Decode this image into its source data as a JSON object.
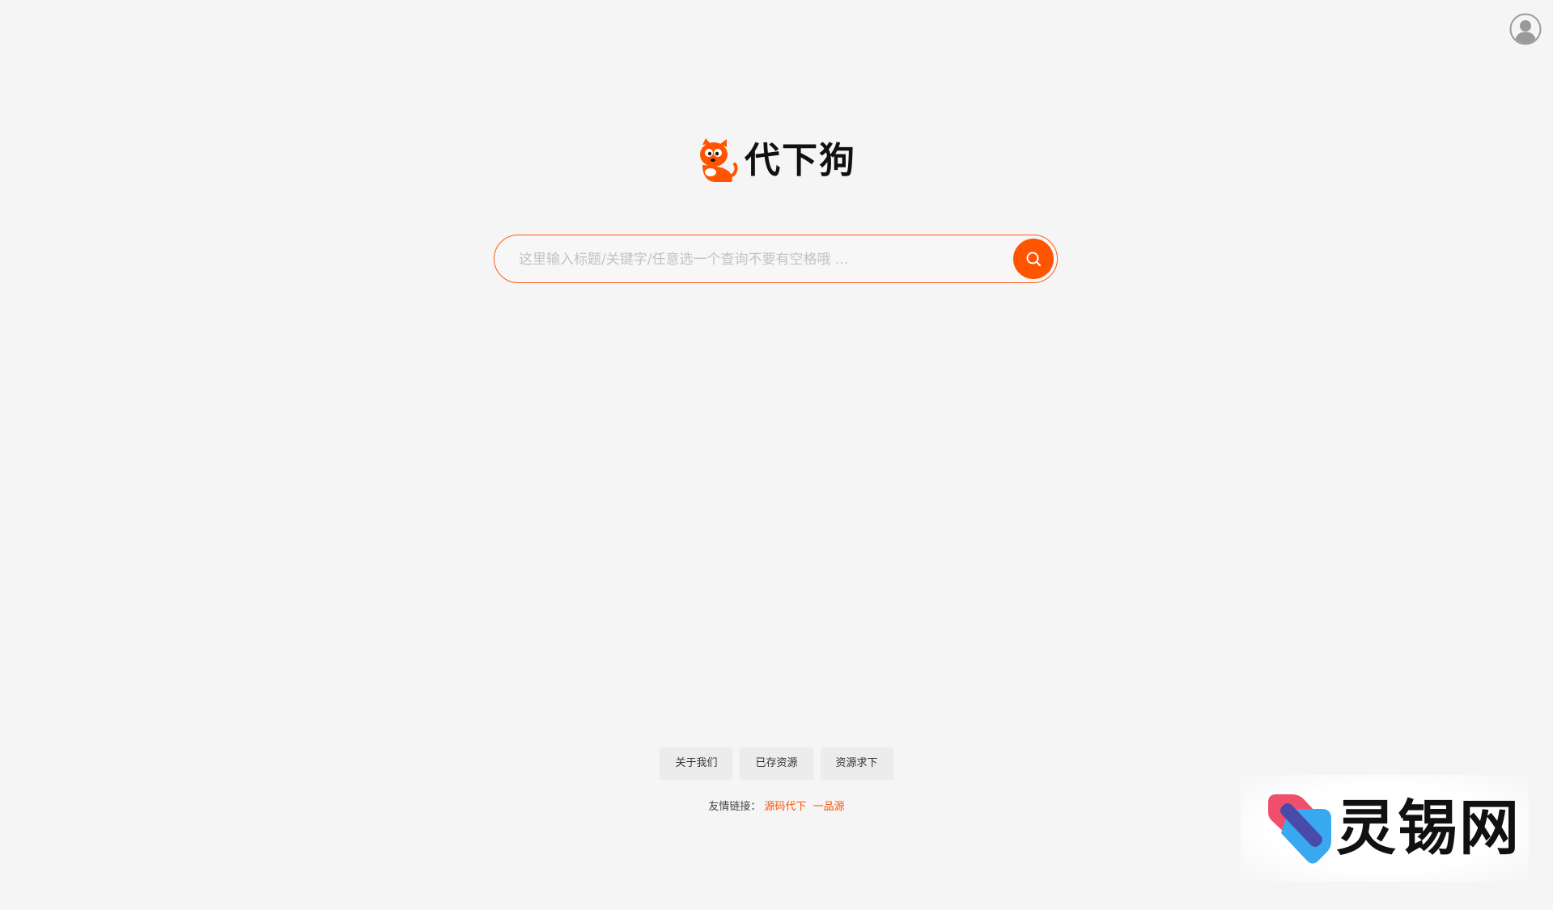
{
  "header": {
    "avatar_icon": "user-avatar-icon"
  },
  "logo": {
    "text": "代下狗",
    "brand_color": "#ff5400",
    "mascot_icon": "dog-mascot-icon"
  },
  "search": {
    "placeholder": "这里输入标题/关键字/任意选一个查询不要有空格哦 ...",
    "value": "",
    "button_icon": "search-icon",
    "accent_color": "#ff5400"
  },
  "footer": {
    "nav": [
      {
        "label": "关于我们"
      },
      {
        "label": "已存资源"
      },
      {
        "label": "资源求下"
      }
    ],
    "links_label": "友情链接：",
    "links": [
      {
        "label": "源码代下"
      },
      {
        "label": "一品源"
      }
    ]
  },
  "watermark": {
    "text": "灵锡网"
  }
}
